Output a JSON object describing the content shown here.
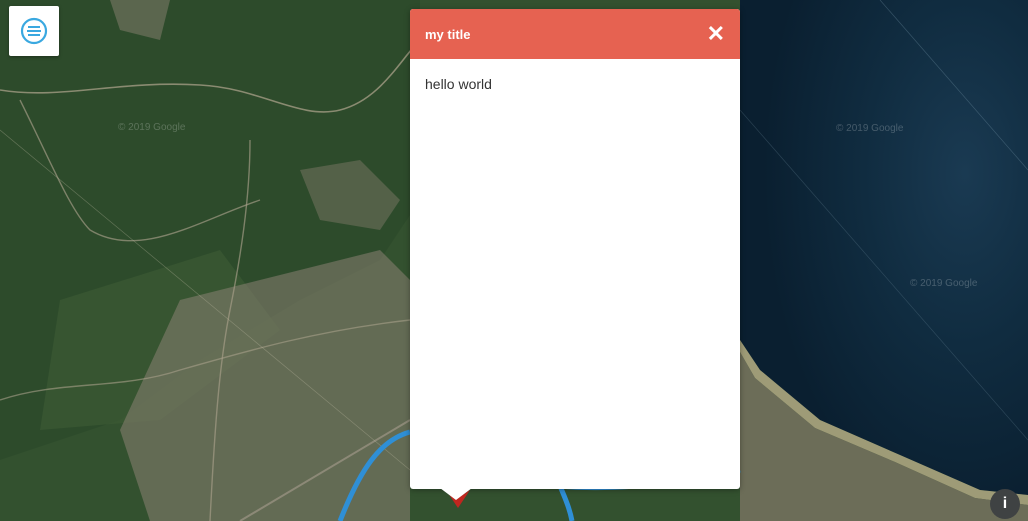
{
  "popup": {
    "title": "my title",
    "close_glyph": "✕",
    "body": "hello world"
  },
  "map": {
    "watermarks": [
      "© 2019 Google",
      "© 2019 Google",
      "© 2019 Google"
    ],
    "info_label": "i",
    "menu_icon": "menu-icon"
  },
  "colors": {
    "popup_header": "#e66251",
    "route": "#2f8fd6",
    "marker": "#c0261f",
    "sea": "#0f2a3f",
    "land": "#2f4a2e"
  }
}
